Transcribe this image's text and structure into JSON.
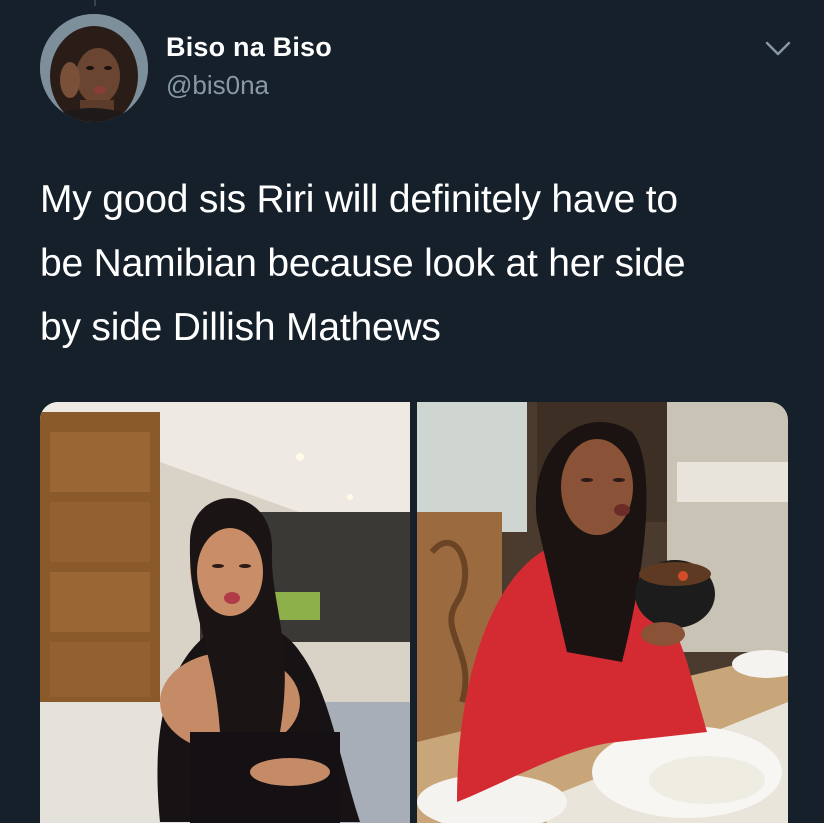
{
  "tweet": {
    "author": {
      "display_name": "Biso na Biso",
      "handle": "@bis0na"
    },
    "text_lines": [
      "My good sis Riri will definitely have to",
      "be Namibian because look at her side",
      "by side Dillish Mathews"
    ],
    "media": [
      {
        "kind": "photo"
      },
      {
        "kind": "photo"
      }
    ],
    "icons": {
      "more": "chevron-down-icon"
    }
  },
  "colors": {
    "background": "#15202b",
    "primary_text": "#ffffff",
    "secondary_text": "#8899a6",
    "divider": "#38444d"
  }
}
